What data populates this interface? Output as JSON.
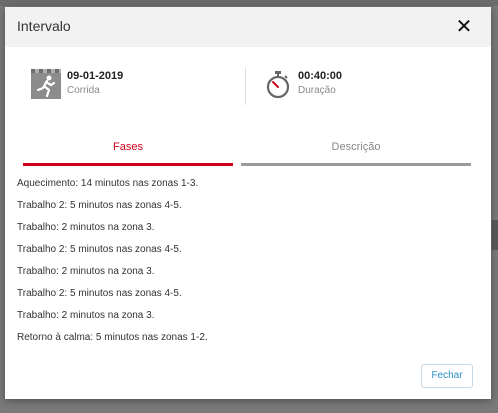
{
  "modal": {
    "title": "Intervalo",
    "close_icon": "close-icon"
  },
  "summary": {
    "date": "09-01-2019",
    "activity": "Corrida",
    "activity_icon": "runner-icon",
    "duration": "00:40:00",
    "duration_label": "Duração",
    "duration_icon": "stopwatch-icon"
  },
  "tabs": [
    {
      "label": "Fases",
      "active": true
    },
    {
      "label": "Descrição",
      "active": false
    }
  ],
  "phases": [
    "Aquecimento: 14 minutos nas zonas 1-3.",
    "Trabalho 2: 5 minutos nas zonas 4-5.",
    "Trabalho: 2 minutos na zona 3.",
    "Trabalho 2: 5 minutos nas zonas 4-5.",
    "Trabalho: 2 minutos na zona 3.",
    "Trabalho 2: 5 minutos nas zonas 4-5.",
    "Trabalho: 2 minutos na zona 3.",
    "Retorno à calma: 5 minutos nas zonas 1-2."
  ],
  "footer": {
    "close_label": "Fechar"
  },
  "colors": {
    "accent": "#d0021b",
    "link": "#2a8ec8"
  }
}
